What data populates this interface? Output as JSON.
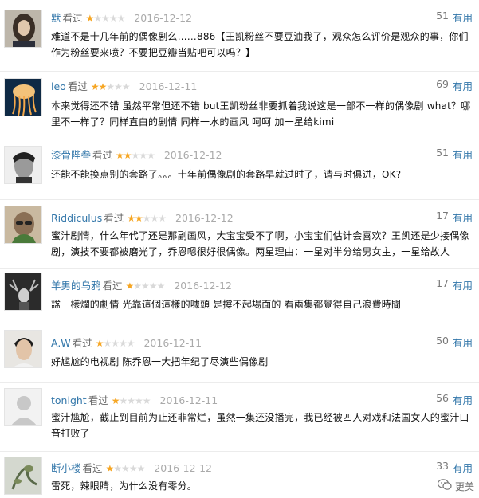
{
  "reviews": [
    {
      "user": "默",
      "seen": "看过",
      "rating": 1,
      "date": "2016-12-12",
      "votes": "51",
      "useful": "有用",
      "avatar": "avatar-woman-long-hair",
      "text": "难道不是十几年前的偶像剧么……886【王凯粉丝不要豆油我了，观众怎么评价是观众的事，你们作为粉丝要来喷？不要把豆瓣当贴吧可以吗？】"
    },
    {
      "user": "leo",
      "seen": "看过",
      "rating": 2,
      "date": "2016-12-11",
      "votes": "69",
      "useful": "有用",
      "avatar": "avatar-jellyfish",
      "text": "本来觉得还不错 虽然平常但还不错 but王凯粉丝非要抓着我说这是一部不一样的偶像剧 what？哪里不一样了？同样直白的剧情 同样一水的画风 呵呵 加一星给kimi"
    },
    {
      "user": "漆骨陛叁",
      "seen": "看过",
      "rating": 2,
      "date": "2016-12-12",
      "votes": "51",
      "useful": "有用",
      "avatar": "avatar-man-bw",
      "text": "还能不能换点别的套路了。。。十年前偶像剧的套路早就过时了，请与时俱进，OK?"
    },
    {
      "user": "Riddiculus",
      "seen": "看过",
      "rating": 2,
      "date": "2016-12-12",
      "votes": "17",
      "useful": "有用",
      "avatar": "avatar-man-glasses",
      "text": "蜜汁剧情，什么年代了还是那副画风，大宝宝受不了啊，小宝宝们估计会喜欢？王凯还是少接偶像剧，演技不要都被磨光了，乔恩嗯很好很偶像。两星理由：一星对半分给男女主，一星给故人"
    },
    {
      "user": "羊男的乌鸦",
      "seen": "看过",
      "rating": 1,
      "date": "2016-12-12",
      "votes": "17",
      "useful": "有用",
      "avatar": "avatar-antler-dark",
      "text": "諡一樣爛的劇情 光靠這個這樣的噱頭 是撐不起場面的 看兩集都覺得自己浪費時間"
    },
    {
      "user": "A.W",
      "seen": "看过",
      "rating": 1,
      "date": "2016-12-11",
      "votes": "50",
      "useful": "有用",
      "avatar": "avatar-man-portrait",
      "text": "好尴尬的电视剧 陈乔恩一大把年纪了尽演些偶像剧"
    },
    {
      "user": "tonight",
      "seen": "看过",
      "rating": 1,
      "date": "2016-12-11",
      "votes": "56",
      "useful": "有用",
      "avatar": "avatar-default",
      "text": "蜜汁尴尬，截止到目前为止还非常烂，虽然一集还没播完，我已经被四人对戏和法国女人的蜜汁口音打败了"
    },
    {
      "user": "断小楼",
      "seen": "看过",
      "rating": 1,
      "date": "2016-12-12",
      "votes": "33",
      "useful": "有用",
      "avatar": "avatar-plant",
      "text": "雷死，辣眼睛，为什么没有零分。"
    }
  ],
  "watermark": {
    "label": "更美",
    "icon": "wechat-icon"
  }
}
